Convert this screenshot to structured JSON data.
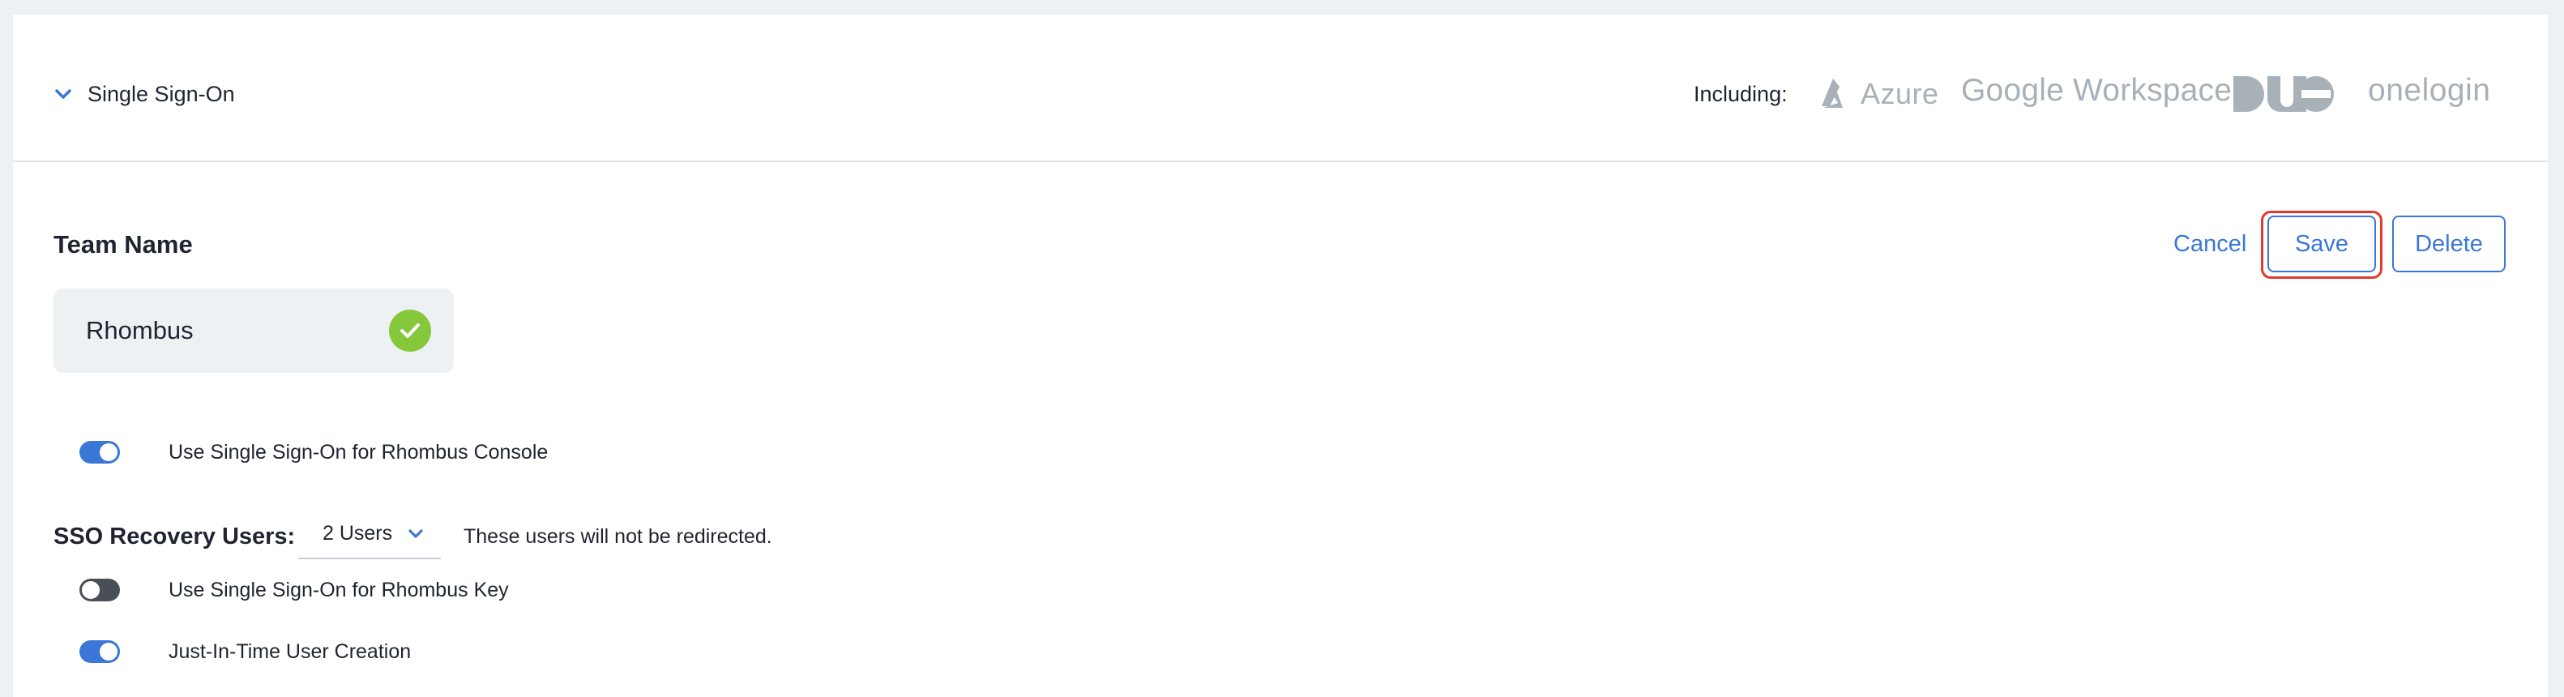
{
  "header": {
    "title": "Single Sign-On",
    "including_label": "Including:",
    "logos": {
      "azure": "Azure",
      "google": "Google Workspace",
      "duo": "DUO",
      "onelogin": "onelogin"
    }
  },
  "team": {
    "label": "Team Name",
    "value": "Rhombus"
  },
  "actions": {
    "cancel": "Cancel",
    "save": "Save",
    "delete": "Delete"
  },
  "settings": {
    "console_sso": {
      "label": "Use Single Sign-On for Rhombus Console",
      "enabled": true
    },
    "key_sso": {
      "label": "Use Single Sign-On for Rhombus Key",
      "enabled": false
    },
    "jit": {
      "label": "Just-In-Time User Creation",
      "enabled": true
    }
  },
  "recovery": {
    "label": "SSO Recovery Users:",
    "selected": "2 Users",
    "note": "These users will not be redirected."
  },
  "colors": {
    "accent": "#3a77d6",
    "success": "#86c83c",
    "highlight": "#e03a2e",
    "logo_gray": "#a8b0b8"
  }
}
